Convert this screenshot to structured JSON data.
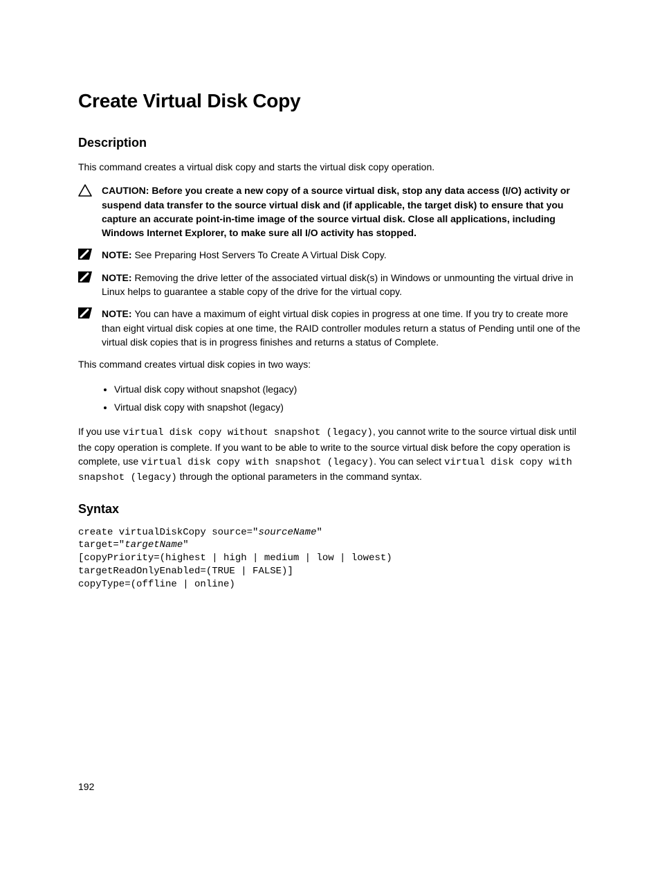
{
  "title": "Create Virtual Disk Copy",
  "description_heading": "Description",
  "intro": "This command creates a virtual disk copy and starts the virtual disk copy operation.",
  "caution_label": "CAUTION: ",
  "caution_text": "Before you create a new copy of a source virtual disk, stop any data access (I/O) activity or suspend data transfer to the source virtual disk and (if applicable, the target disk) to ensure that you capture an accurate point-in-time image of the source virtual disk. Close all applications, including Windows Internet Explorer, to make sure all I/O activity has stopped.",
  "note_label": "NOTE: ",
  "note1": "See Preparing Host Servers To Create A Virtual Disk Copy.",
  "note2": "Removing the drive letter of the associated virtual disk(s) in Windows or unmounting the virtual drive in Linux helps to guarantee a stable copy of the drive for the virtual copy.",
  "note3": "You can have a maximum of eight virtual disk copies in progress at one time. If you try to create more than eight virtual disk copies at one time, the RAID controller modules return a status of Pending until one of the virtual disk copies that is in progress finishes and returns a status of Complete.",
  "two_ways": "This command creates virtual disk copies in two ways:",
  "bullets": [
    "Virtual disk copy without snapshot (legacy)",
    "Virtual disk copy with snapshot (legacy)"
  ],
  "p2_a": "If you use ",
  "p2_code1": "virtual disk copy without snapshot (legacy)",
  "p2_b": ", you cannot write to the source virtual disk until the copy operation is complete. If you want to be able to write to the source virtual disk before the copy operation is complete, use ",
  "p2_code2": "virtual disk copy with snapshot (legacy)",
  "p2_c": ". You can select ",
  "p2_code3": "virtual disk copy with snapshot (legacy)",
  "p2_d": " through the optional parameters in the command syntax.",
  "syntax_heading": "Syntax",
  "syntax": {
    "l1a": "create virtualDiskCopy source=\"",
    "l1b": "sourceName",
    "l1c": "\"",
    "l2a": "target=\"",
    "l2b": "targetName",
    "l2c": "\"",
    "l3": "[copyPriority=(highest | high | medium | low | lowest)",
    "l4": "targetReadOnlyEnabled=(TRUE | FALSE)]",
    "l5": "copyType=(offline | online)"
  },
  "page_number": "192"
}
